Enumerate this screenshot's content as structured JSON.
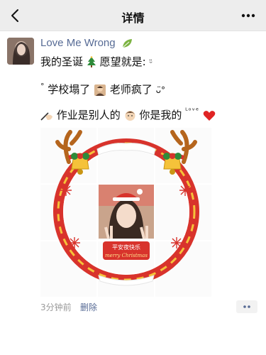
{
  "nav": {
    "title": "详情"
  },
  "post": {
    "username": "Love Me Wrong",
    "lines": [
      "我的圣诞 🎄愿望就是:",
      "° 学校塌了 🧑‍🏫老师疯了",
      "✍🏻作业是别人的 👦🏻你是我的"
    ],
    "line1_text": "我的圣诞",
    "line1_text2": "愿望就是",
    "line2_text1": "学校塌了",
    "line2_text2": "老师疯了",
    "line3_text1": "作业是别人的",
    "line3_text2": "你是我的",
    "love_small": "ᴸᵒᵛᵉ",
    "image_caption_cn": "平安夜快乐",
    "image_caption_en": "merry Christmas",
    "time": "3分钟前",
    "delete_label": "删除"
  },
  "icons": {
    "back": "chevron-left-icon",
    "more": "ellipsis-icon",
    "leaf": "leaf-icon"
  },
  "colors": {
    "nav_bg": "#ededed",
    "link": "#576b95",
    "wreath_red": "#d8332c",
    "wreath_yellow": "#f5c23a"
  }
}
